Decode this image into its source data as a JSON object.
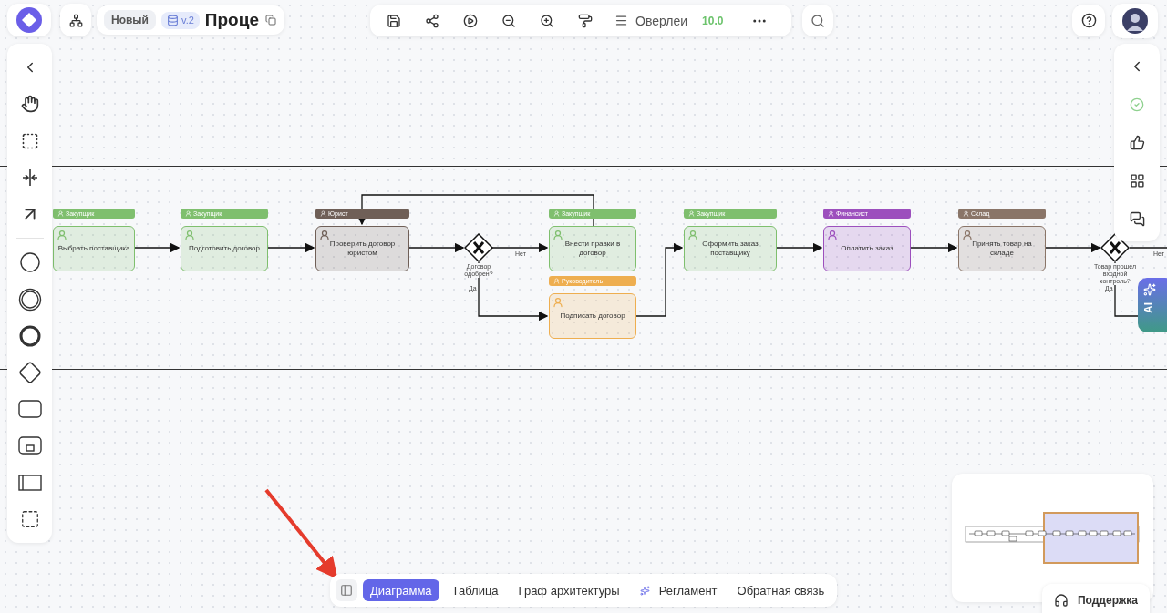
{
  "header": {
    "status": "Новый",
    "version": "v.2",
    "title": "Проце"
  },
  "toolbar": {
    "overlay_label": "Оверлеи",
    "overlay_score": "10.0"
  },
  "diagram": {
    "nodes": [
      {
        "kind": "task",
        "role": "Закупщик",
        "color": "#7fbf6e",
        "text": "Выбрать поставщика"
      },
      {
        "kind": "task",
        "role": "Закупщик",
        "color": "#7fbf6e",
        "text": "Подготовить договор"
      },
      {
        "kind": "task",
        "role": "Юрист",
        "color": "#6f5f57",
        "text": "Проверить договор юристом"
      },
      {
        "kind": "gateway",
        "text": "Договор одобрен?",
        "no": "Нет",
        "yes": "Да"
      },
      {
        "kind": "task",
        "role": "Закупщик",
        "color": "#7fbf6e",
        "text": "Внести правки в договор"
      },
      {
        "kind": "task",
        "role": "Руководитель",
        "color": "#eeae50",
        "text": "Подписать договор"
      },
      {
        "kind": "task",
        "role": "Закупщик",
        "color": "#7fbf6e",
        "text": "Оформить заказ поставщику"
      },
      {
        "kind": "task",
        "role": "Финансист",
        "color": "#9c4fbd",
        "text": "Оплатить заказ"
      },
      {
        "kind": "task",
        "role": "Склад",
        "color": "#8a7568",
        "text": "Принять товар на складе"
      },
      {
        "kind": "gateway",
        "text": "Товар прошел входной контроль?",
        "no": "Нет",
        "yes": "Да"
      }
    ]
  },
  "ai_button": "AI",
  "tabs": [
    {
      "label": "Диаграмма",
      "selected": true
    },
    {
      "label": "Таблица",
      "selected": false
    },
    {
      "label": "Граф архитектуры",
      "selected": false
    },
    {
      "label": "Регламент",
      "selected": false,
      "kind": "sparkle"
    },
    {
      "label": "Обратная связь",
      "selected": false
    }
  ],
  "support": "Поддержка"
}
